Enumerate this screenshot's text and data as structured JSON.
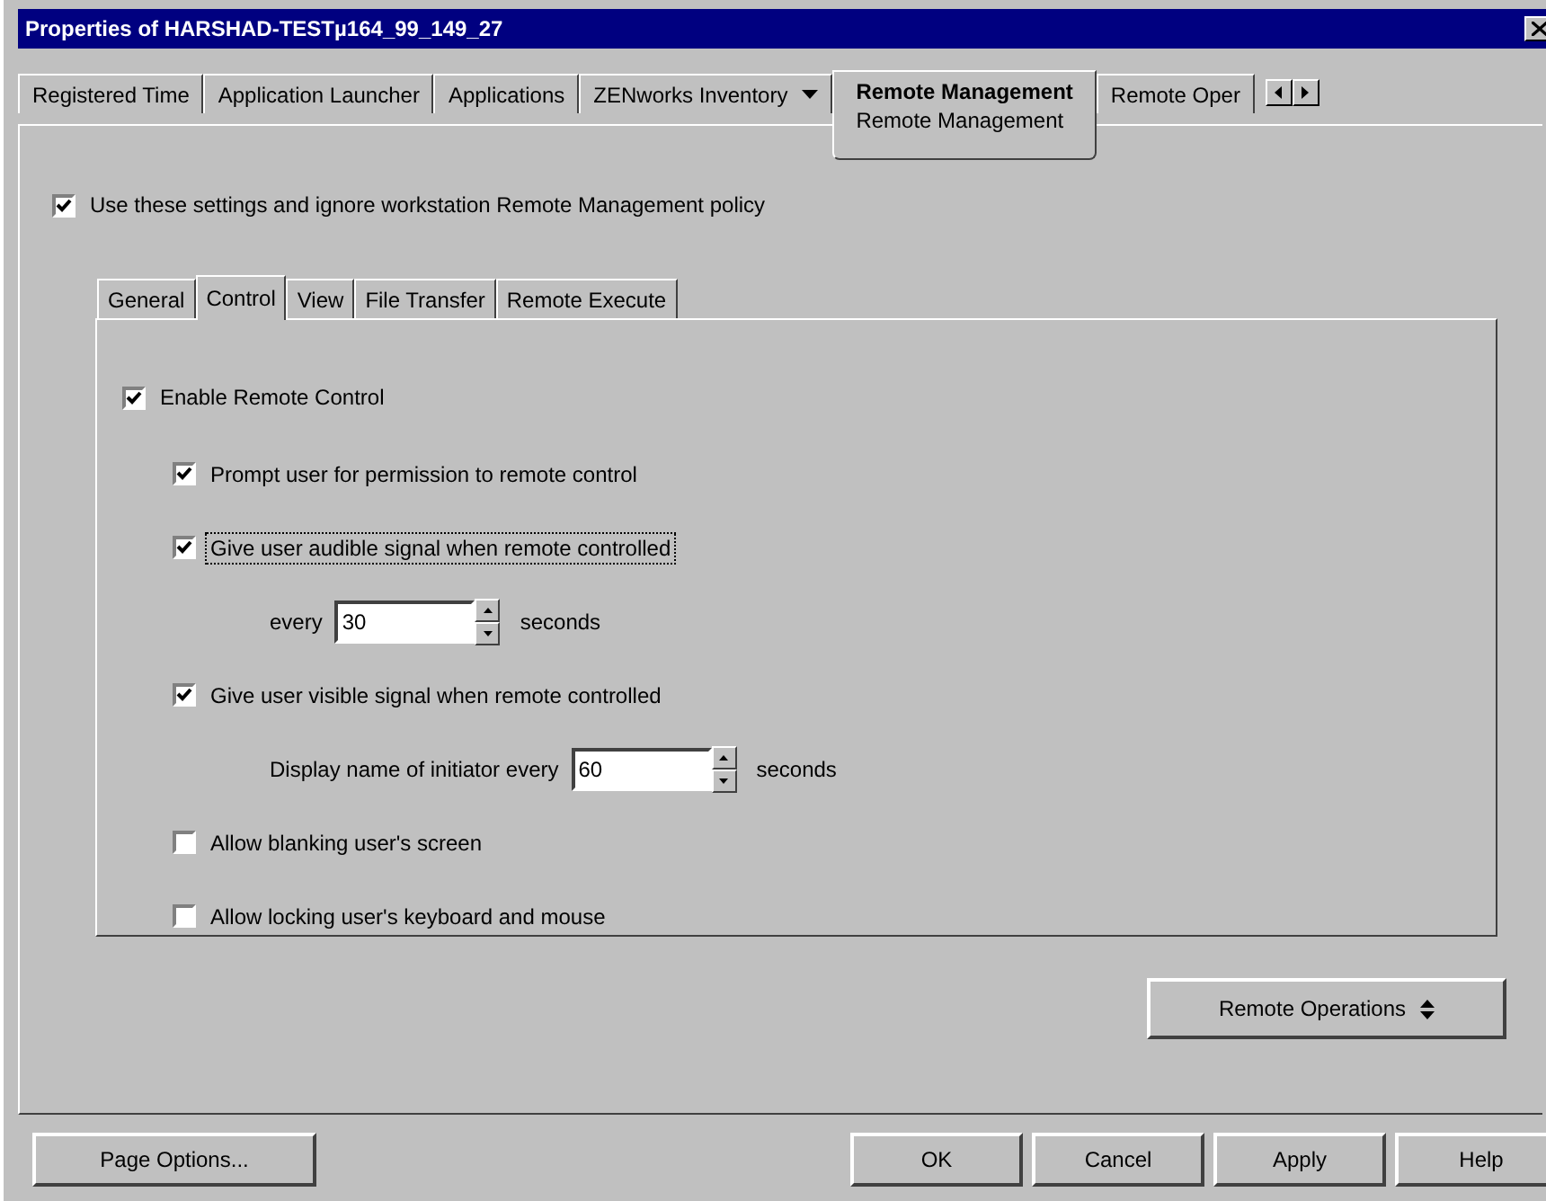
{
  "window": {
    "title": "Properties of HARSHAD-TESTµ164_99_149_27"
  },
  "tabs": [
    {
      "label": "Registered Time",
      "selected": false,
      "dropdown": false
    },
    {
      "label": "Application Launcher",
      "selected": false,
      "dropdown": false
    },
    {
      "label": "Applications",
      "selected": false,
      "dropdown": false
    },
    {
      "label": "ZENworks Inventory",
      "selected": false,
      "dropdown": true
    },
    {
      "label": "Remote Management",
      "sublabel": "Remote Management",
      "selected": true,
      "dropdown": false
    },
    {
      "label": "Remote Oper",
      "selected": false,
      "dropdown": false
    }
  ],
  "override": {
    "label": "Use these settings and ignore workstation Remote Management policy",
    "checked": true
  },
  "subtabs": [
    {
      "label": "General",
      "selected": false
    },
    {
      "label": "Control",
      "selected": true
    },
    {
      "label": "View",
      "selected": false
    },
    {
      "label": "File Transfer",
      "selected": false
    },
    {
      "label": "Remote Execute",
      "selected": false
    }
  ],
  "options": [
    {
      "kind": "checkbox",
      "label": "Enable Remote Control",
      "checked": true,
      "focused": false,
      "children": [
        {
          "kind": "checkbox",
          "label": "Prompt user for permission to remote control",
          "checked": true,
          "focused": false
        },
        {
          "kind": "checkbox",
          "label": "Give user audible signal when remote controlled",
          "checked": true,
          "focused": true,
          "children": [
            {
              "kind": "spinner",
              "label": "every",
              "value": "30",
              "unit": "seconds"
            }
          ]
        },
        {
          "kind": "checkbox",
          "label": "Give user visible signal when remote controlled",
          "checked": true,
          "focused": false,
          "children": [
            {
              "kind": "spinner",
              "label": "Display name of initiator every",
              "value": "60",
              "unit": "seconds"
            }
          ]
        },
        {
          "kind": "checkbox",
          "label": "Allow blanking user's screen",
          "checked": false,
          "focused": false
        },
        {
          "kind": "checkbox",
          "label": "Allow locking user's keyboard and mouse",
          "checked": false,
          "focused": false
        }
      ]
    }
  ],
  "remote_operations": {
    "label": "Remote Operations"
  },
  "buttons": {
    "left": [
      "Page Options..."
    ],
    "right": [
      "OK",
      "Cancel",
      "Apply",
      "Help"
    ]
  }
}
